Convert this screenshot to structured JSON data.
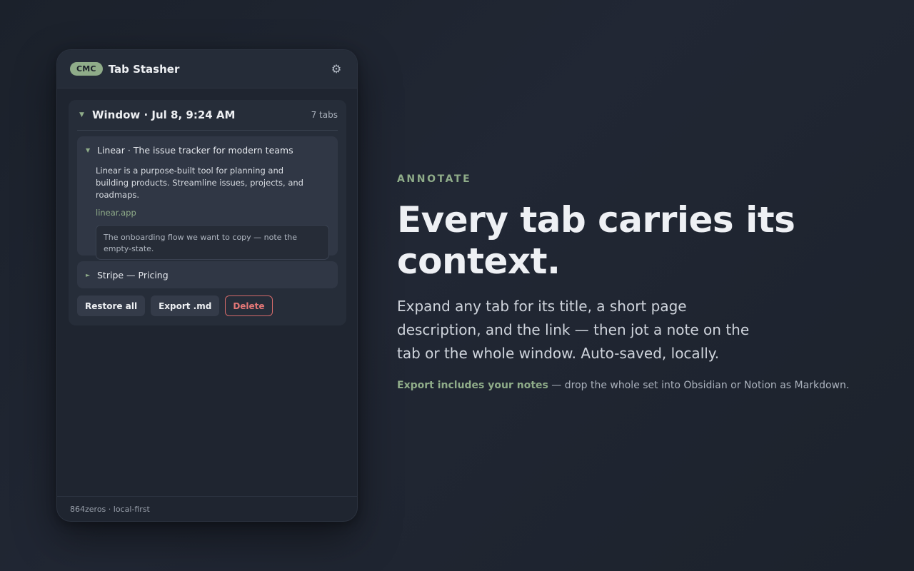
{
  "popup": {
    "brand_badge": "CMC",
    "app_name": "Tab Stasher",
    "settings_icon": "gear-icon",
    "window": {
      "title": "Window · Jul 8, 9:24 AM",
      "tab_count": "7 tabs",
      "tabs": [
        {
          "title": "Linear · The issue tracker for modern teams",
          "description": "Linear is a purpose-built tool for planning and building products. Streamline issues, projects, and roadmaps.",
          "link": "linear.app",
          "note": "The onboarding flow we want to copy — note the empty-state.",
          "expanded": true
        },
        {
          "title": "Stripe — Pricing",
          "expanded": false
        }
      ],
      "actions": {
        "restore": "Restore all",
        "export": "Export .md",
        "delete": "Delete"
      }
    },
    "footer": "864zeros · local-first"
  },
  "copy": {
    "eyebrow": "ANNOTATE",
    "headline": "Every tab carries its context.",
    "lead": "Expand any tab for its title, a short page description, and the link — then jot a note on the tab or the whole window. Auto-saved, locally.",
    "note_accent": "Export includes your notes",
    "note_rest": " — drop the whole set into Obsidian or Notion as Markdown."
  },
  "colors": {
    "accent": "#8fac89",
    "danger": "#e47777",
    "background": "#1f2530"
  }
}
